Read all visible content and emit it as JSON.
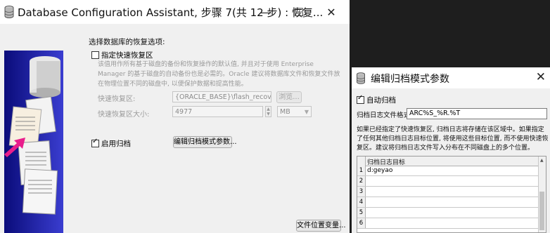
{
  "main_window": {
    "title": "Database Configuration Assistant, 步骤 7(共 12 步) : 恢复...",
    "minimize": "—",
    "maximize": "☐",
    "close": "✕"
  },
  "recovery": {
    "section_title": "选择数据库的恢复选项:",
    "fra_checkbox_label": "指定快速恢复区",
    "fra_checked": false,
    "description": "该值用作所有基于磁盘的备份和恢复操作的默认值, 并且对于使用 Enterprise Manager 的基于磁盘的自动备份也是必需的。Oracle 建议将数据库文件和恢复文件放在物理位置不同的磁盘中, 以便保护数据和提高性能。",
    "fra_location_label": "快速恢复区:",
    "fra_location_value": "{ORACLE_BASE}\\flash_recovery_area",
    "browse_button": "浏览...",
    "fra_size_label": "快速恢复区大小:",
    "fra_size_value": "4977",
    "fra_size_unit": "MB",
    "archive_checkbox_label": "启用归档",
    "archive_checked": true,
    "edit_archive_button": "编辑归档模式参数...",
    "file_location_vars_button": "文件位置变量..."
  },
  "dialog": {
    "title": "编辑归档模式参数",
    "close": "✕",
    "auto_archive_label": "自动归档",
    "auto_archive_checked": true,
    "log_format_label": "归档日志文件格式",
    "log_format_value": "ARC%S_%R.%T",
    "description": "如果已经指定了快速恢复区, 归档日志将存储在该区域中。如果指定了任何其他归档日志目标位置, 将使用这些目标位置, 而不使用快速恢复区。建议将归档日志文件写入分布在不同磁盘上的多个位置。",
    "table_header": "归档日志目标",
    "rows": [
      {
        "num": "1",
        "value": "d:geyao"
      },
      {
        "num": "2",
        "value": ""
      },
      {
        "num": "3",
        "value": ""
      },
      {
        "num": "4",
        "value": ""
      },
      {
        "num": "5",
        "value": ""
      },
      {
        "num": "6",
        "value": ""
      }
    ]
  }
}
